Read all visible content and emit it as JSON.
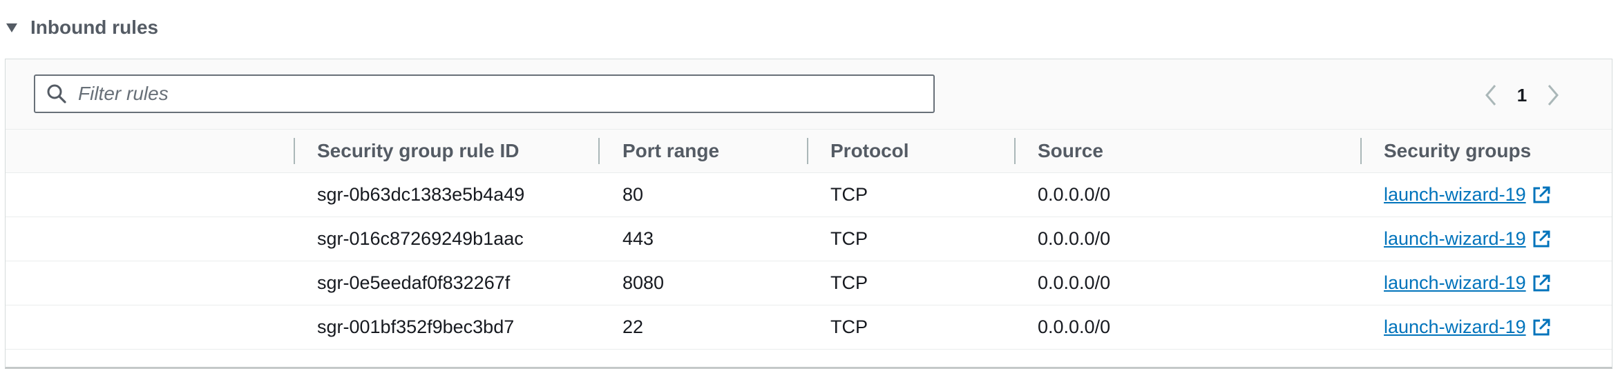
{
  "section": {
    "title": "Inbound rules"
  },
  "filter": {
    "placeholder": "Filter rules",
    "value": ""
  },
  "pagination": {
    "current_page": "1"
  },
  "table": {
    "columns": [
      "Security group rule ID",
      "Port range",
      "Protocol",
      "Source",
      "Security groups"
    ],
    "rows": [
      {
        "rule_id": "sgr-0b63dc1383e5b4a49",
        "port_range": "80",
        "protocol": "TCP",
        "source": "0.0.0.0/0",
        "security_group": "launch-wizard-19"
      },
      {
        "rule_id": "sgr-016c87269249b1aac",
        "port_range": "443",
        "protocol": "TCP",
        "source": "0.0.0.0/0",
        "security_group": "launch-wizard-19"
      },
      {
        "rule_id": "sgr-0e5eedaf0f832267f",
        "port_range": "8080",
        "protocol": "TCP",
        "source": "0.0.0.0/0",
        "security_group": "launch-wizard-19"
      },
      {
        "rule_id": "sgr-001bf352f9bec3bd7",
        "port_range": "22",
        "protocol": "TCP",
        "source": "0.0.0.0/0",
        "security_group": "launch-wizard-19"
      }
    ]
  },
  "colors": {
    "link": "#0073bb",
    "header_text": "#545b64",
    "text": "#16191f",
    "border": "#d5dbdb"
  },
  "icons": {
    "collapse": "caret-down-icon",
    "search": "search-icon",
    "prev": "chevron-left-icon",
    "next": "chevron-right-icon",
    "external": "external-link-icon"
  }
}
